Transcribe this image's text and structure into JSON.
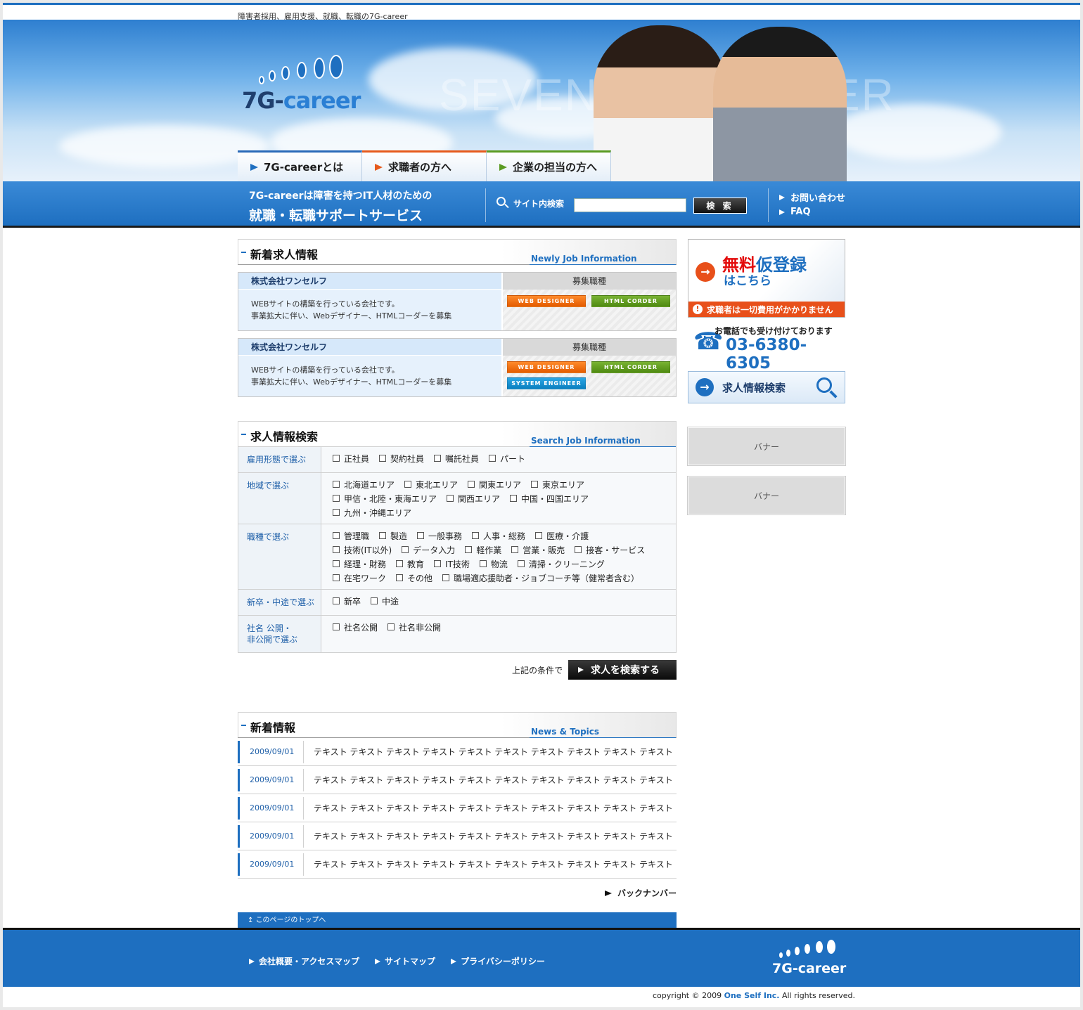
{
  "header": {
    "tagline": "障害者採用、雇用支援、就職、転職の7G-career",
    "logo_text_a": "7G-",
    "logo_text_b": "career",
    "ghost_text": "SEVEN GO CAREER",
    "nav": [
      {
        "label": "7G-careerとは"
      },
      {
        "label": "求職者の方へ"
      },
      {
        "label": "企業の担当の方へ"
      }
    ],
    "band_line1": "7G-careerは障害を持つIT人材のための",
    "band_line2": "就職・転職サポートサービス",
    "search_label": "サイト内検索",
    "search_value": "",
    "search_button": "検 索",
    "links": [
      "お問い合わせ",
      "FAQ"
    ]
  },
  "jobs": {
    "title": "新着求人情報",
    "title_en": "Newly Job Information",
    "kind_header": "募集職種",
    "items": [
      {
        "company": "株式会社ワンセルフ",
        "desc1": "WEBサイトの構築を行っている会社です。",
        "desc2": "事業拡大に伴い、Webデザイナー、HTMLコーダーを募集",
        "tags": [
          "WEB DESIGNER",
          "HTML CORDER"
        ]
      },
      {
        "company": "株式会社ワンセルフ",
        "desc1": "WEBサイトの構築を行っている会社です。",
        "desc2": "事業拡大に伴い、Webデザイナー、HTMLコーダーを募集",
        "tags": [
          "WEB DESIGNER",
          "HTML CORDER",
          "SYSTEM ENGINEER"
        ]
      }
    ]
  },
  "search": {
    "title": "求人情報検索",
    "title_en": "Search Job Information",
    "rows": [
      {
        "label": "雇用形態で選ぶ",
        "lines": [
          [
            "正社員",
            "契約社員",
            "嘱託社員",
            "パート"
          ]
        ]
      },
      {
        "label": "地域で選ぶ",
        "lines": [
          [
            "北海道エリア",
            "東北エリア",
            "関東エリア",
            "東京エリア"
          ],
          [
            "甲信・北陸・東海エリア",
            "関西エリア",
            "中国・四国エリア"
          ],
          [
            "九州・沖縄エリア"
          ]
        ]
      },
      {
        "label": "職種で選ぶ",
        "lines": [
          [
            "管理職",
            "製造",
            "一般事務",
            "人事・総務",
            "医療・介護"
          ],
          [
            "技術(IT以外)",
            "データ入力",
            "軽作業",
            "営業・販売",
            "接客・サービス"
          ],
          [
            "経理・財務",
            "教育",
            "IT技術",
            "物流",
            "清掃・クリーニング"
          ],
          [
            "在宅ワーク",
            "その他",
            "職場適応援助者・ジョブコーチ等（健常者含む）"
          ]
        ]
      },
      {
        "label": "新卒・中途で選ぶ",
        "lines": [
          [
            "新卒",
            "中途"
          ]
        ]
      },
      {
        "label": "社名 公開・\n非公開で選ぶ",
        "lines": [
          [
            "社名公開",
            "社名非公開"
          ]
        ]
      }
    ],
    "go_prefix": "上記の条件で",
    "go_button": "求人を検索する"
  },
  "news": {
    "title": "新着情報",
    "title_en": "News & Topics",
    "items": [
      {
        "date": "2009/09/01",
        "text": "テキスト テキスト テキスト テキスト テキスト テキスト テキスト テキスト テキスト テキスト"
      },
      {
        "date": "2009/09/01",
        "text": "テキスト テキスト テキスト テキスト テキスト テキスト テキスト テキスト テキスト テキスト"
      },
      {
        "date": "2009/09/01",
        "text": "テキスト テキスト テキスト テキスト テキスト テキスト テキスト テキスト テキスト テキスト"
      },
      {
        "date": "2009/09/01",
        "text": "テキスト テキスト テキスト テキスト テキスト テキスト テキスト テキスト テキスト テキスト"
      },
      {
        "date": "2009/09/01",
        "text": "テキスト テキスト テキスト テキスト テキスト テキスト テキスト テキスト テキスト テキスト"
      }
    ],
    "backnumber": "バックナンバー"
  },
  "side": {
    "reg_red": "無料",
    "reg_blue": "仮登録",
    "reg_sub": "はこちら",
    "reg_note": "求職者は一切費用がかかりません",
    "phone_note": "お電話でも受け付けております",
    "phone_number": "03-6380-6305",
    "search_label": "求人情報検索",
    "banners": [
      "バナー",
      "バナー"
    ]
  },
  "footer": {
    "pagetop": "このページのトップへ",
    "links": [
      "会社概要・アクセスマップ",
      "サイトマップ",
      "プライバシーポリシー"
    ],
    "logo_text": "7G-career",
    "copyright_pre": "copyright © 2009 ",
    "copyright_company": "One Self Inc.",
    "copyright_post": " All rights reserved."
  },
  "colors": {
    "brand_blue": "#1e6fc0",
    "accent_orange": "#e8501a",
    "accent_green": "#5a9b22"
  }
}
